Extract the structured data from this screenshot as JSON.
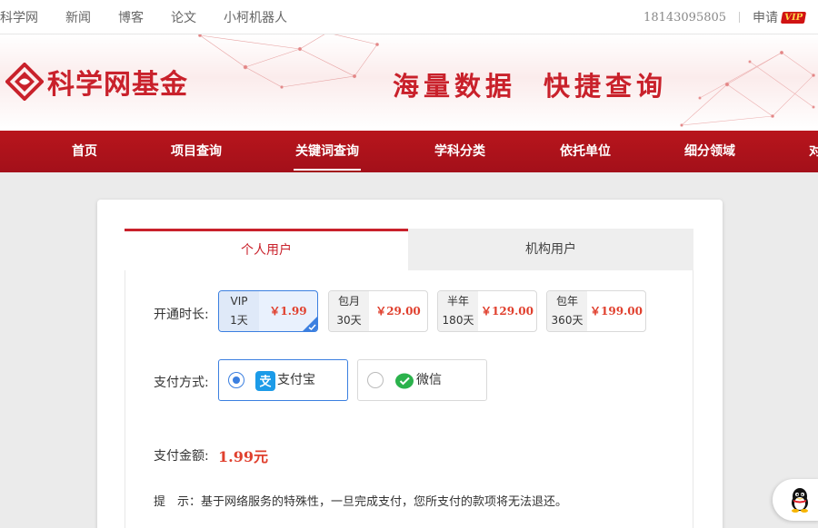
{
  "topbar": {
    "links": [
      "科学网",
      "新闻",
      "博客",
      "论文",
      "小柯机器人"
    ],
    "phone": "18143095805",
    "apply": "申请",
    "vip_badge": "VIP"
  },
  "banner": {
    "logo_text": "科学网基金",
    "slogan_a": "海量数据",
    "slogan_b": "快捷查询"
  },
  "mainnav": {
    "items": [
      "首页",
      "项目查询",
      "关键词查询",
      "学科分类",
      "依托单位",
      "细分领域",
      "对"
    ],
    "active_index": 2
  },
  "tabs": {
    "personal": "个人用户",
    "org": "机构用户"
  },
  "duration": {
    "label": "开通时长:",
    "plans": [
      {
        "top": "VIP",
        "bottom": "1天",
        "price": "￥1.99",
        "selected": true
      },
      {
        "top": "包月",
        "bottom": "30天",
        "price": "￥29.00",
        "selected": false
      },
      {
        "top": "半年",
        "bottom": "180天",
        "price": "￥129.00",
        "selected": false
      },
      {
        "top": "包年",
        "bottom": "360天",
        "price": "￥199.00",
        "selected": false
      }
    ]
  },
  "payment": {
    "label": "支付方式:",
    "alipay": "支付宝",
    "wechat": "微信",
    "selected": "alipay"
  },
  "amount": {
    "label": "支付金额:",
    "value": "1.99元"
  },
  "tip": "提　示：基于网络服务的特殊性，一旦完成支付，您所支付的款项将无法退还。",
  "colors": {
    "brand_red": "#c9212b",
    "price_red": "#e0402e",
    "select_blue": "#3b7fe0",
    "alipay_blue": "#1c9be8",
    "wechat_green": "#2bb24c"
  }
}
